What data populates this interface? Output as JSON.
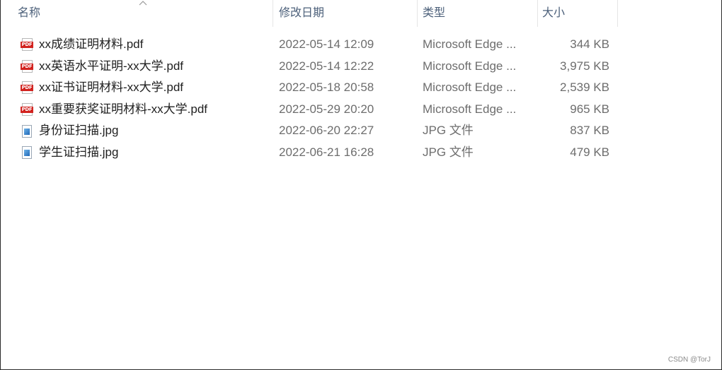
{
  "columns": {
    "name": "名称",
    "date": "修改日期",
    "type": "类型",
    "size": "大小"
  },
  "sort_indicator": "chevron-up-icon",
  "files": [
    {
      "name": "xx成绩证明材料.pdf",
      "date": "2022-05-14 12:09",
      "type": "Microsoft Edge ...",
      "size": "344 KB",
      "icon": "pdf-file-icon"
    },
    {
      "name": "xx英语水平证明-xx大学.pdf",
      "date": "2022-05-14 12:22",
      "type": "Microsoft Edge ...",
      "size": "3,975 KB",
      "icon": "pdf-file-icon"
    },
    {
      "name": "xx证书证明材料-xx大学.pdf",
      "date": "2022-05-18 20:58",
      "type": "Microsoft Edge ...",
      "size": "2,539 KB",
      "icon": "pdf-file-icon"
    },
    {
      "name": "xx重要获奖证明材料-xx大学.pdf",
      "date": "2022-05-29 20:20",
      "type": "Microsoft Edge ...",
      "size": "965 KB",
      "icon": "pdf-file-icon"
    },
    {
      "name": "身份证扫描.jpg",
      "date": "2022-06-20 22:27",
      "type": "JPG 文件",
      "size": "837 KB",
      "icon": "image-file-icon"
    },
    {
      "name": "学生证扫描.jpg",
      "date": "2022-06-21 16:28",
      "type": "JPG 文件",
      "size": "479 KB",
      "icon": "image-file-icon"
    }
  ],
  "pdf_badge_text": "PDF",
  "watermark": "CSDN @TorJ",
  "colors": {
    "header_text": "#4c607a",
    "pdf_red": "#d2231f",
    "image_blue": "#1e68b8"
  }
}
